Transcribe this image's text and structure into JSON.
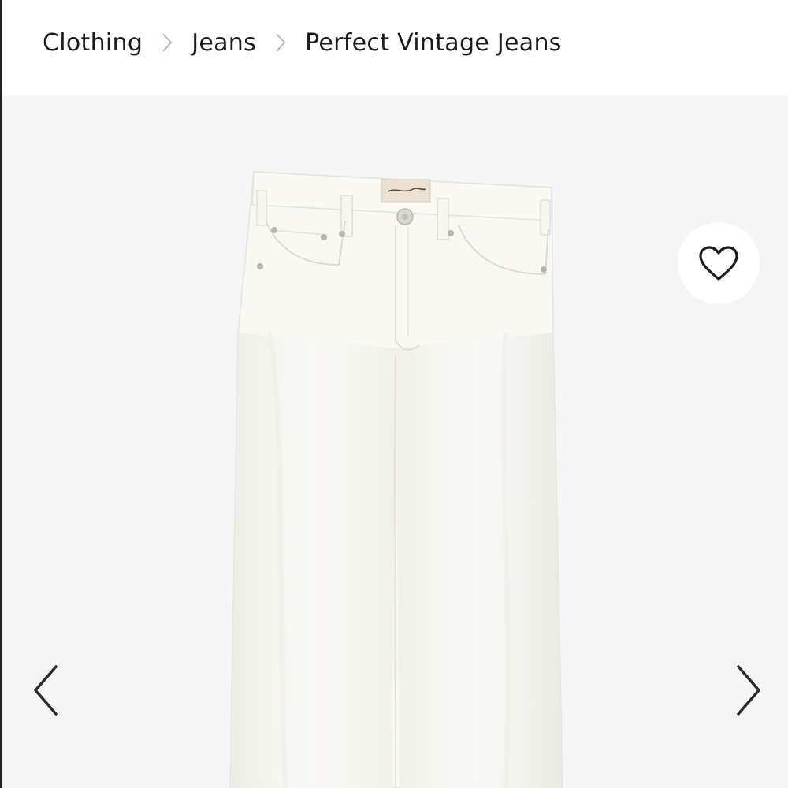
{
  "breadcrumb": {
    "items": [
      {
        "label": "Clothing"
      },
      {
        "label": "Jeans"
      },
      {
        "label": "Perfect Vintage Jeans"
      }
    ],
    "separator_icon": "chevron-right-icon"
  },
  "gallery": {
    "product_image": "white-high-rise-jeans",
    "favorite_icon": "heart-icon",
    "prev_icon": "chevron-left-icon",
    "next_icon": "chevron-right-icon"
  },
  "colors": {
    "text": "#1a1a1a",
    "separator": "#b8b8b8",
    "gallery_bg": "#f5f5f6",
    "denim": "#f7f6f0"
  }
}
